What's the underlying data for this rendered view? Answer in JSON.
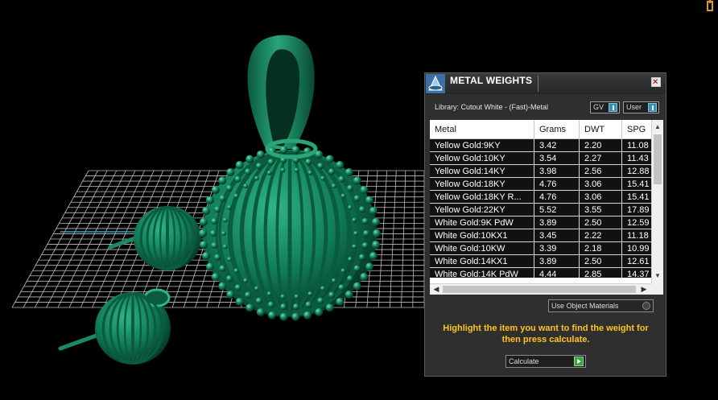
{
  "panel": {
    "title": "METAL WEIGHTS",
    "library_label": "Library: Cutout White - (Fast)-Metal",
    "toggles": {
      "gv": "GV",
      "user": "User"
    },
    "columns": [
      "Metal",
      "Grams",
      "DWT",
      "SPG"
    ],
    "rows": [
      [
        "Yellow Gold:9KY",
        "3.42",
        "2.20",
        "11.08"
      ],
      [
        "Yellow Gold:10KY",
        "3.54",
        "2.27",
        "11.43"
      ],
      [
        "Yellow Gold:14KY",
        "3.98",
        "2.56",
        "12.88"
      ],
      [
        "Yellow Gold:18KY",
        "4.76",
        "3.06",
        "15.41"
      ],
      [
        "Yellow Gold:18KY R...",
        "4.76",
        "3.06",
        "15.41"
      ],
      [
        "Yellow Gold:22KY",
        "5.52",
        "3.55",
        "17.89"
      ],
      [
        "White Gold:9K PdW",
        "3.89",
        "2.50",
        "12.59"
      ],
      [
        "White Gold:10KX1",
        "3.45",
        "2.22",
        "11.18"
      ],
      [
        "White Gold:10KW",
        "3.39",
        "2.18",
        "10.99"
      ],
      [
        "White Gold:14KX1",
        "3.89",
        "2.50",
        "12.61"
      ],
      [
        "White Gold:14K PdW",
        "4.44",
        "2.85",
        "14.37"
      ]
    ],
    "use_object_materials": "Use Object Materials",
    "help_text": "Highlight the item you want to find the weight for then press calculate.",
    "calculate_label": "Calculate"
  },
  "colors": {
    "background": "#000000",
    "model_green": "#0f7a55",
    "grid": "#cfcfcf",
    "help_text": "#ffc41a"
  },
  "icons": [
    "app-logo-icon",
    "close-icon",
    "toggle-icon",
    "radio-icon",
    "play-arrow-icon",
    "scroll-up-icon",
    "scroll-down-icon",
    "scroll-left-icon",
    "scroll-right-icon",
    "figure-icon"
  ]
}
